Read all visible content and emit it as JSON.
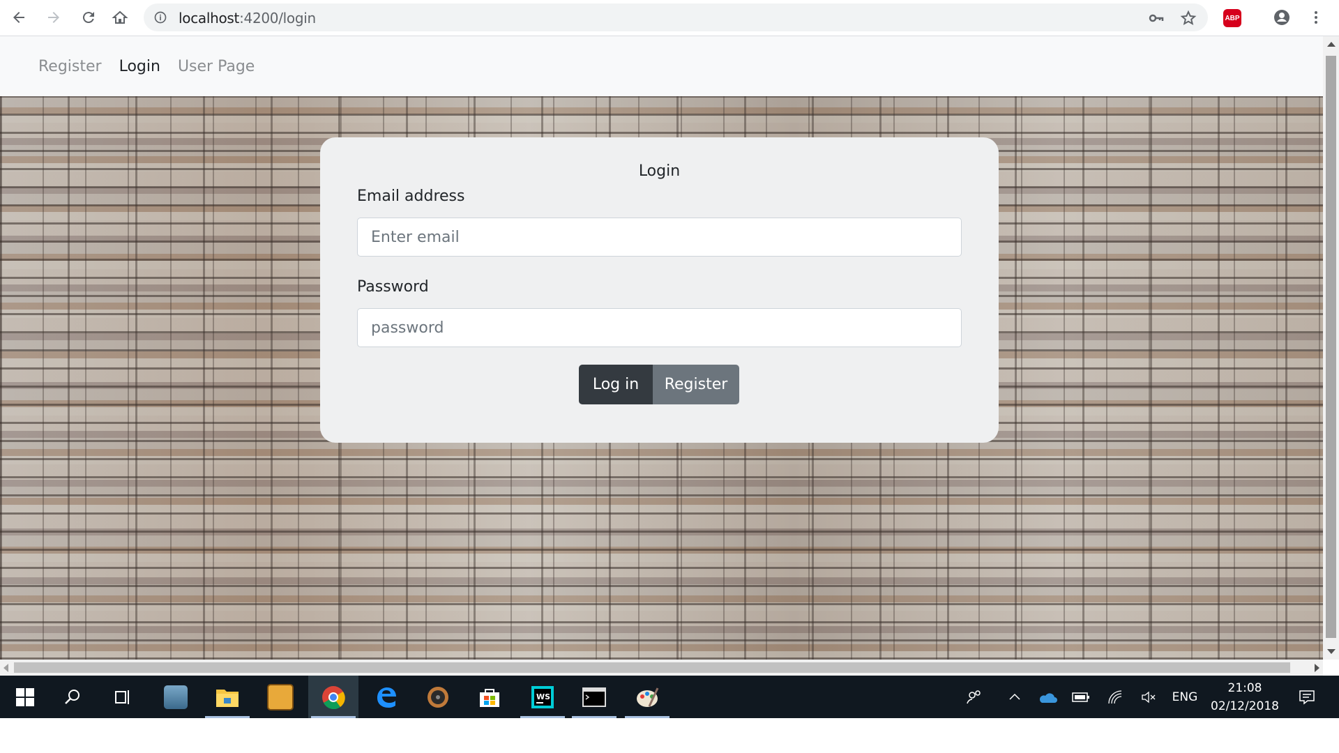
{
  "browser": {
    "url_host": "localhost",
    "url_rest": ":4200/login"
  },
  "nav": {
    "links": [
      "Register",
      "Login",
      "User Page"
    ],
    "active": "Login"
  },
  "login": {
    "title": "Login",
    "email_label": "Email address",
    "email_placeholder": "Enter email",
    "password_label": "Password",
    "password_placeholder": "password",
    "login_button": "Log in",
    "register_button": "Register"
  },
  "taskbar": {
    "apps": [
      "start",
      "search",
      "task-view",
      "pdf-reader",
      "file-explorer",
      "app-pinned",
      "chrome",
      "edge",
      "media",
      "store",
      "webstorm",
      "terminal",
      "paint"
    ],
    "active_app": "chrome",
    "language": "ENG",
    "time": "21:08",
    "date": "02/12/2018"
  },
  "colors": {
    "navbar_bg": "#f8f9fa",
    "card_bg": "#eff0f1",
    "login_btn": "#343a40",
    "register_btn": "#6c757d",
    "taskbar_bg": "#101820"
  }
}
